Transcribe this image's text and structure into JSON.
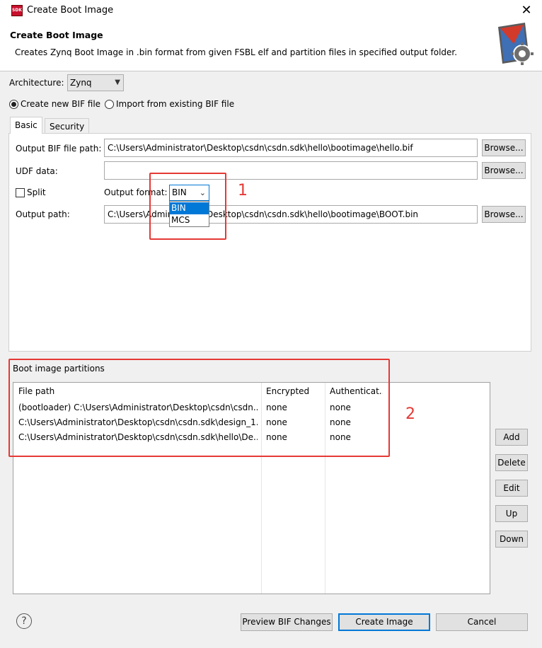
{
  "window": {
    "title": "Create Boot Image",
    "app_icon_text": "SDK"
  },
  "header": {
    "title": "Create Boot Image",
    "description": "Creates Zynq Boot Image in .bin format from given FSBL elf and partition files in specified output folder."
  },
  "architecture": {
    "label": "Architecture:",
    "value": "Zynq"
  },
  "bif_mode": {
    "create_label": "Create new BIF file",
    "import_label": "Import from existing BIF file",
    "selected": "create"
  },
  "tabs": [
    {
      "label": "Basic"
    },
    {
      "label": "Security"
    }
  ],
  "basic": {
    "output_bif_label": "Output BIF file path:",
    "output_bif_value": "C:\\Users\\Administrator\\Desktop\\csdn\\csdn.sdk\\hello\\bootimage\\hello.bif",
    "udf_label": "UDF data:",
    "udf_value": "",
    "split_label": "Split",
    "output_format_label": "Output format:",
    "output_format_value": "BIN",
    "output_format_options": [
      "BIN",
      "MCS"
    ],
    "output_path_label": "Output path:",
    "output_path_value": "C:\\Users\\Administrator\\Desktop\\csdn\\csdn.sdk\\hello\\bootimage\\BOOT.bin",
    "browse_label": "Browse..."
  },
  "partitions": {
    "title": "Boot image partitions",
    "columns": [
      "File path",
      "Encrypted",
      "Authenticat..."
    ],
    "rows": [
      [
        "(bootloader) C:\\Users\\Administrator\\Desktop\\csdn\\csdn...",
        "none",
        "none"
      ],
      [
        "C:\\Users\\Administrator\\Desktop\\csdn\\csdn.sdk\\design_1...",
        "none",
        "none"
      ],
      [
        "C:\\Users\\Administrator\\Desktop\\csdn\\csdn.sdk\\hello\\De...",
        "none",
        "none"
      ]
    ],
    "buttons": {
      "add": "Add",
      "delete": "Delete",
      "edit": "Edit",
      "up": "Up",
      "down": "Down"
    }
  },
  "annotations": {
    "one": "1",
    "two": "2"
  },
  "footer": {
    "help": "?",
    "preview": "Preview BIF Changes",
    "create": "Create Image",
    "cancel": "Cancel"
  },
  "colors": {
    "annotation_red": "#e53935",
    "selection_blue": "#0078d7",
    "primary_border": "#0078d7"
  }
}
